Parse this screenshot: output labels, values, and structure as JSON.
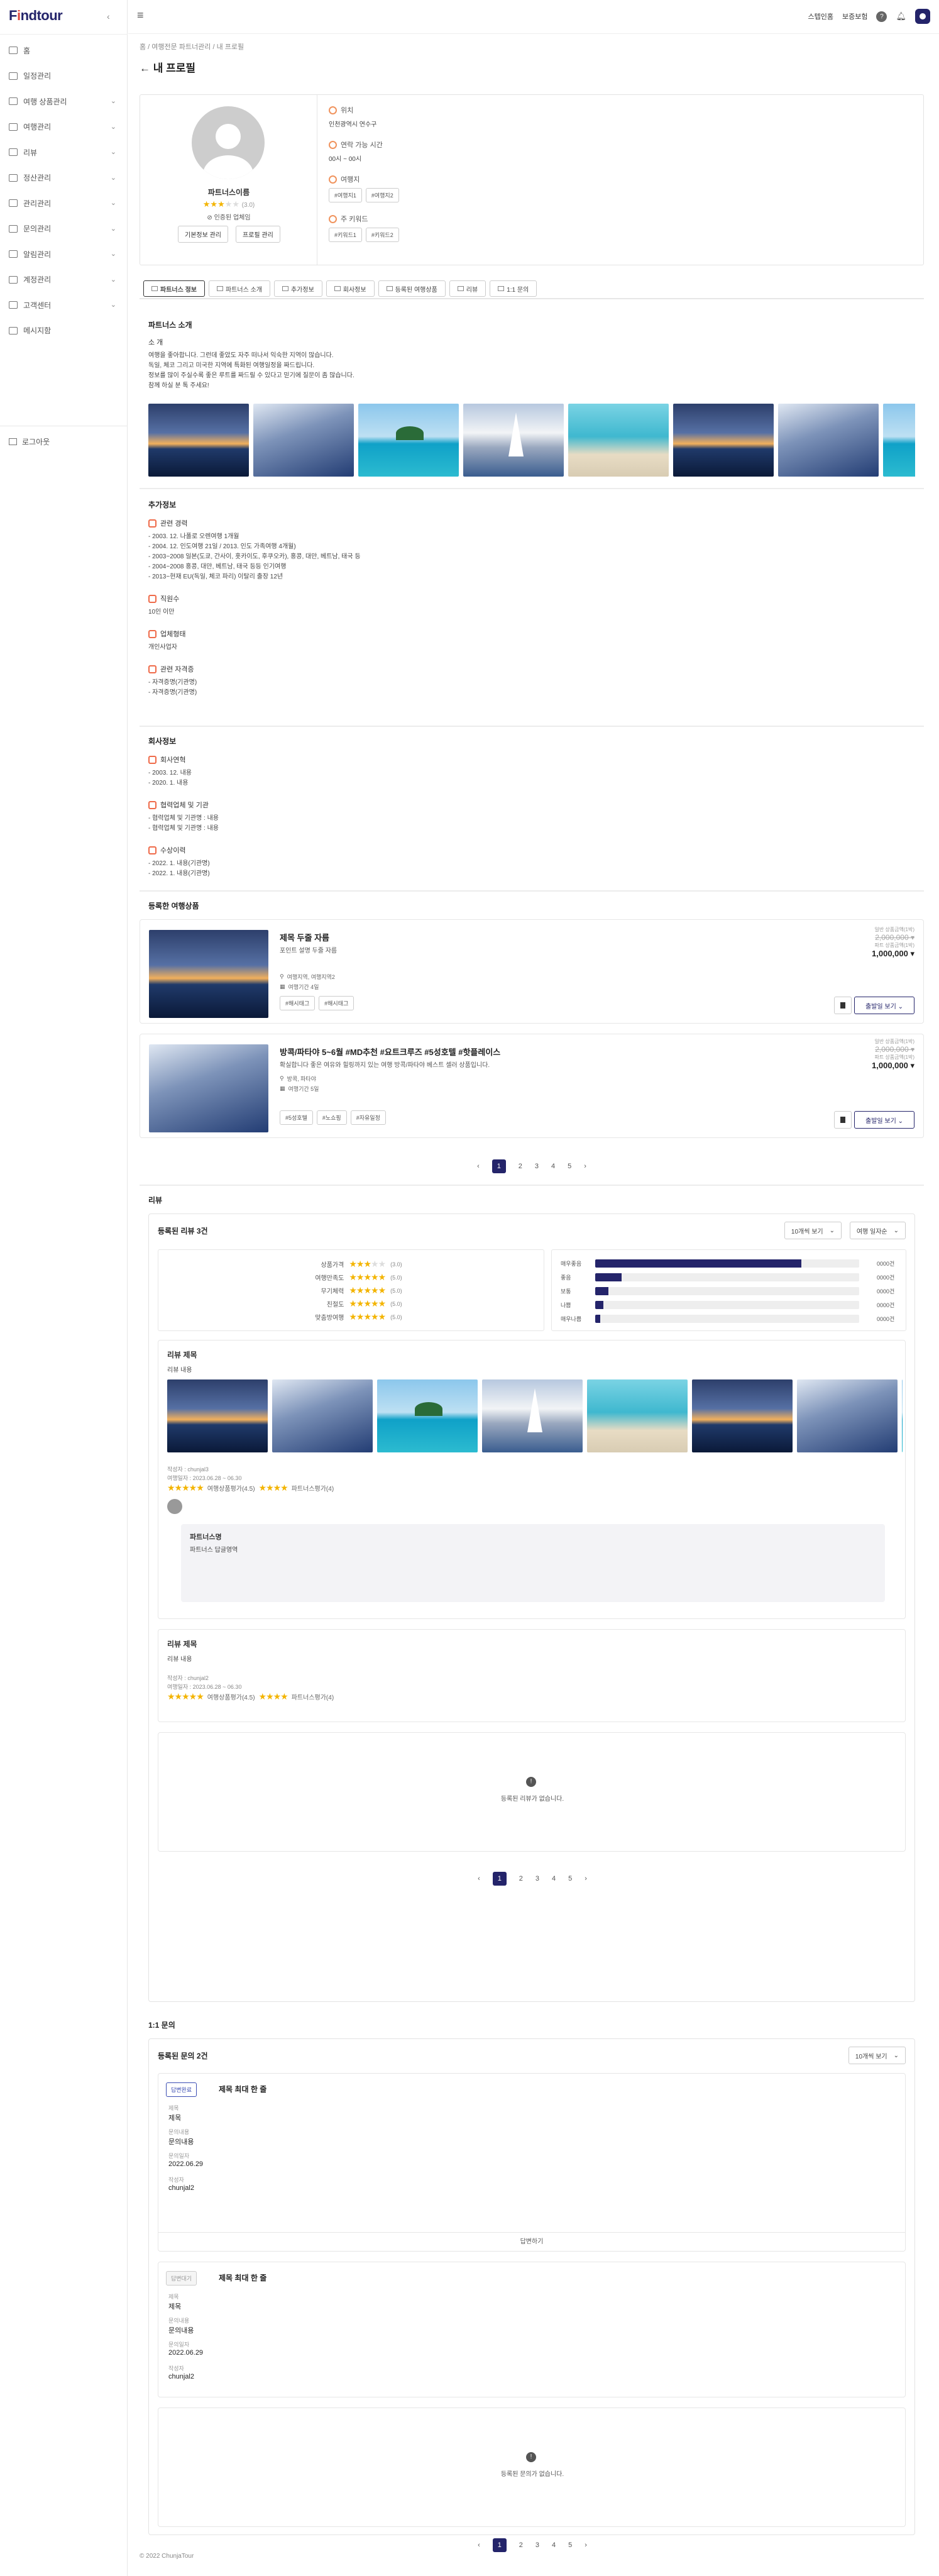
{
  "brand": {
    "logo_prefix": "F",
    "logo_o": "i",
    "logo_suffix": "ndtour"
  },
  "sidebar": {
    "items": [
      {
        "label": "홈",
        "chev": false
      },
      {
        "label": "일정관리",
        "chev": false
      },
      {
        "label": "여행 상품관리",
        "chev": true
      },
      {
        "label": "여행관리",
        "chev": true
      },
      {
        "label": "리뷰",
        "chev": true
      },
      {
        "label": "정산관리",
        "chev": true
      },
      {
        "label": "관리관리",
        "chev": true
      },
      {
        "label": "문의관리",
        "chev": true
      },
      {
        "label": "알림관리",
        "chev": true
      },
      {
        "label": "계정관리",
        "chev": true
      },
      {
        "label": "고객센터",
        "chev": true
      },
      {
        "label": "메시지함",
        "chev": false
      }
    ],
    "logout": "로그아웃"
  },
  "topbar": {
    "link1": "스텝인홈",
    "link2": "보증보험",
    "help": "?"
  },
  "breadcrumb": "홈 / 여행전문 파트너관리 / 내 프로필",
  "page_title": "← 내 프로필",
  "profile": {
    "name": "파트너스이름",
    "rating": "(3.0)",
    "verified": "인증된 업체임",
    "btn_basic": "기본정보 관리",
    "btn_profile": "프로필 관리",
    "location_label": "위치",
    "location": "인천광역시 연수구",
    "contact_label": "연락 가능 시간",
    "contact": "00시 ~ 00시",
    "region_label": "여행지",
    "regions": [
      "#여행지1",
      "#여행지2"
    ],
    "keyword_label": "주 키워드",
    "keywords": [
      "#키워드1",
      "#키워드2"
    ]
  },
  "tabs": [
    "파트너스 정보",
    "파트너스 소개",
    "추가정보",
    "회사정보",
    "등록된 여행상품",
    "리뷰",
    "1:1 문의"
  ],
  "intro": {
    "section": "파트너스 소개",
    "sub": "소 개",
    "lines": [
      "여행을 좋아합니다. 그런데 좋았도 자주 떠나서 익숙한 지역이 많습니다.",
      "독일, 체코 그리고 미국한 지역에 특화된 여행일정을 짜드립니다.",
      "정보를 많이 주실수록 좋은 루트를 짜드릴 수 있다고 믿기에 질문이 좀 많습니다.",
      "참께 하실 분 톡 주세요!"
    ]
  },
  "extra": {
    "section": "추가정보",
    "career_label": "관련 경력",
    "career": [
      "- 2003. 12. 나폴로 오렌여행 1개월",
      "- 2004. 12. 인도여행 21일 / 2013. 인도 가족여행 4개월)",
      "- 2003~2008 일본(도쿄, 간사이, 홋카이도, 후쿠오카), 홍콩, 대만, 베트남, 태국 등",
      "- 2004~2008 홍콩, 대만, 베트남, 태국 등등 인기여행",
      "- 2013~현재 EU(독일, 체코 파리) 이탈리 출장 12년"
    ],
    "staff_label": "직원수",
    "staff": "10인 이만",
    "biz_label": "업체형태",
    "biz": "개인사업자",
    "cert_label": "관련 자격증",
    "certs": [
      "- 자격증명(기관명)",
      "- 자격증명(기관명)"
    ]
  },
  "company": {
    "section": "회사정보",
    "hist_label": "회사연혁",
    "hist": [
      "- 2003. 12. 내용",
      "- 2020. 1. 내용"
    ],
    "partner_label": "협력업체 및 기관",
    "partners": [
      "- 협력업체 및 기관명 : 내용",
      "- 협력업체 및 기관명 : 내용"
    ],
    "award_label": "수상이력",
    "awards": [
      "- 2022. 1. 내용(기관명)",
      "- 2022. 1. 내용(기관명)"
    ]
  },
  "products": {
    "section": "등록한 여행상품",
    "items": [
      {
        "title": "제목 두줄 자름",
        "sub": "포인트 설명 두줄 자름",
        "loc": "여행지역, 여행지역2",
        "period": "여행기간 4일",
        "tags": [
          "#해시태그",
          "#해시태그"
        ],
        "price_label1": "일반 상품금액(1박)",
        "price1": "2,000,000 ▾",
        "price_label2": "파트 상품금액(1박)",
        "price2": "1,000,000 ▾"
      },
      {
        "title": "방콕/파타야 5~6월 #MD추천 #요트크루즈 #5성호텔 #핫플레이스",
        "sub": "확실합니다 좋은 여유와 힐링까지 있는 여행 방콕/파타야 베스트 셀러 상품입니다.",
        "loc": "방콕, 파타야",
        "period": "여행기간 5일",
        "tags": [
          "#5성호텔",
          "#노쇼핑",
          "#자유일정"
        ],
        "price_label1": "일반 상품금액(1박)",
        "price1": "2,000,000 ▾",
        "price_label2": "파트 상품금액(1박)",
        "price2": "1,000,000 ▾"
      }
    ],
    "bookmark_label": "",
    "go_label": "출발일 보기 ⌄"
  },
  "pagination": [
    "‹",
    "1",
    "2",
    "3",
    "4",
    "5",
    "›"
  ],
  "review": {
    "section": "리뷰",
    "count": "등록된 리뷰 3건",
    "sort1": "10개씩 보기",
    "sort2": "여행 일자순",
    "scores": [
      {
        "label": "상품가격",
        "stars": 3,
        "val": "(3.0)"
      },
      {
        "label": "여행만족도",
        "stars": 5,
        "val": "(5.0)"
      },
      {
        "label": "무기체력",
        "stars": 5,
        "val": "(5.0)"
      },
      {
        "label": "친절도",
        "stars": 5,
        "val": "(5.0)"
      },
      {
        "label": "맞춤방여행",
        "stars": 5,
        "val": "(5.0)"
      }
    ],
    "dist": [
      {
        "label": "매우좋음",
        "pct": 0.78,
        "cnt": "0000건"
      },
      {
        "label": "좋음",
        "pct": 0.1,
        "cnt": "0000건"
      },
      {
        "label": "보통",
        "pct": 0.05,
        "cnt": "0000건"
      },
      {
        "label": "나쁨",
        "pct": 0.03,
        "cnt": "0000건"
      },
      {
        "label": "매우나쁨",
        "pct": 0.02,
        "cnt": "0000건"
      }
    ],
    "r1": {
      "title": "리뷰 제목",
      "body": "리뷰 내용",
      "writer": "작성자 : chunjal3",
      "date": "여행일자 : 2023.06.28 ~ 06.30",
      "s1": "여행상품평가(4.5)",
      "s2": "파트너스평가(4)",
      "reply_name": "파트너스명",
      "reply_body": "파트너스 답글영역"
    },
    "r2": {
      "title": "리뷰 제목",
      "body": "리뷰 내용",
      "writer": "작성자 : chunjal2",
      "date": "여행일자 : 2023.06.28 ~ 06.30",
      "s1": "여행상품평가(4.5)",
      "s2": "파트너스평가(4)"
    },
    "empty": "등록된 리뷰가 없습니다."
  },
  "qna": {
    "section": "1:1 문의",
    "count": "등록된 문의 2건",
    "sort": "10개씩 보기",
    "q1": {
      "status": "답변완료",
      "title": "제목 최대 한 줄",
      "f_title": "제목",
      "v_title": "제목",
      "f_content": "문의내용",
      "v_content": "문의내용",
      "f_date": "문의일자",
      "v_date": "2022.06.29",
      "f_writer": "작성자",
      "v_writer": "chunjal2",
      "bar": "답변하기"
    },
    "q2": {
      "status": "답변대기",
      "title": "제목 최대 한 줄",
      "f_title": "제목",
      "v_title": "제목",
      "f_content": "문의내용",
      "v_content": "문의내용",
      "f_date": "문의일자",
      "v_date": "2022.06.29",
      "f_writer": "작성자",
      "v_writer": "chunjal2"
    },
    "empty": "등록된 문의가 없습니다."
  },
  "footer": "© 2022 ChunjaTour"
}
